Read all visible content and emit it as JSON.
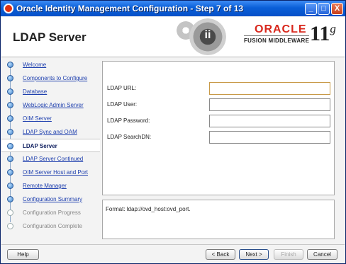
{
  "window": {
    "title": "Oracle Identity Management Configuration - Step 7 of 13",
    "minimize_glyph": "_",
    "maximize_glyph": "□",
    "close_glyph": "X"
  },
  "header": {
    "page_title": "LDAP Server",
    "logo_gear_letter": "ii",
    "brand": "ORACLE",
    "brand_sub": "FUSION MIDDLEWARE",
    "version": "11",
    "version_suffix": "g",
    "brand_color": "#d8271c"
  },
  "nav": {
    "items": [
      {
        "label": "Welcome",
        "state": "done"
      },
      {
        "label": "Components to Configure",
        "state": "done"
      },
      {
        "label": "Database",
        "state": "done"
      },
      {
        "label": "WebLogic Admin Server",
        "state": "done"
      },
      {
        "label": "OIM Server",
        "state": "done"
      },
      {
        "label": "LDAP Sync and OAM",
        "state": "done"
      },
      {
        "label": "LDAP Server",
        "state": "active"
      },
      {
        "label": "LDAP Server Continued",
        "state": "done"
      },
      {
        "label": "OIM Server Host and Port",
        "state": "done"
      },
      {
        "label": "Remote Manager",
        "state": "done"
      },
      {
        "label": "Configuration Summary",
        "state": "done"
      },
      {
        "label": "Configuration Progress",
        "state": "disabled"
      },
      {
        "label": "Configuration Complete",
        "state": "disabled"
      }
    ]
  },
  "form": {
    "ldap_url": {
      "label": "LDAP URL:",
      "value": ""
    },
    "ldap_user": {
      "label": "LDAP User:",
      "value": ""
    },
    "ldap_password": {
      "label": "LDAP Password:",
      "value": ""
    },
    "ldap_search_dn": {
      "label": "LDAP SearchDN:",
      "value": ""
    }
  },
  "help": {
    "text": "Format: ldap://ovd_host:ovd_port."
  },
  "buttons": {
    "help": "Help",
    "back": "< Back",
    "next": "Next >",
    "finish": "Finish",
    "cancel": "Cancel"
  }
}
